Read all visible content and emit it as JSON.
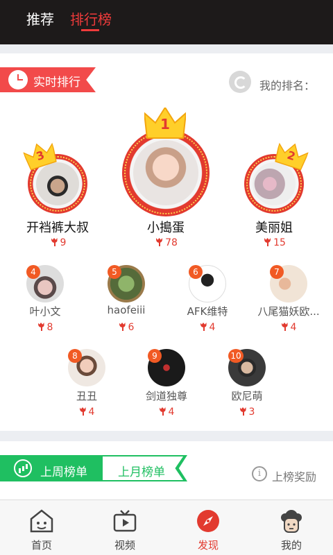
{
  "header": {
    "tabs": [
      {
        "label": "推荐",
        "active": false
      },
      {
        "label": "排行榜",
        "active": true
      }
    ]
  },
  "realtime": {
    "section_label": "实时排行",
    "my_rank_label": "我的排名："
  },
  "podium": [
    {
      "rank": "1",
      "name": "小搗蛋",
      "score": "78"
    },
    {
      "rank": "2",
      "name": "美丽姐",
      "score": "15"
    },
    {
      "rank": "3",
      "name": "开裆裤大叔",
      "score": "9"
    }
  ],
  "list": [
    {
      "rank": "4",
      "name": "叶小文",
      "score": "8"
    },
    {
      "rank": "5",
      "name": "haofeiii",
      "score": "6"
    },
    {
      "rank": "6",
      "name": "AFK维特",
      "score": "4"
    },
    {
      "rank": "7",
      "name": "八尾猫妖欧...",
      "score": "4"
    },
    {
      "rank": "8",
      "name": "丑丑",
      "score": "4"
    },
    {
      "rank": "9",
      "name": "剑道独尊",
      "score": "4"
    },
    {
      "rank": "10",
      "name": "欧尼萌",
      "score": "3"
    }
  ],
  "period_tabs": {
    "week": "上周榜单",
    "month": "上月榜单",
    "reward": "上榜奖励"
  },
  "bottom_nav": [
    {
      "label": "首页",
      "icon": "home-icon",
      "active": false
    },
    {
      "label": "视频",
      "icon": "tv-icon",
      "active": false
    },
    {
      "label": "发现",
      "icon": "compass-icon",
      "active": true
    },
    {
      "label": "我的",
      "icon": "profile-icon",
      "active": false
    }
  ],
  "colors": {
    "accent": "#e23a2f",
    "green": "#1fbf61",
    "topbar": "#1d1a1a"
  }
}
